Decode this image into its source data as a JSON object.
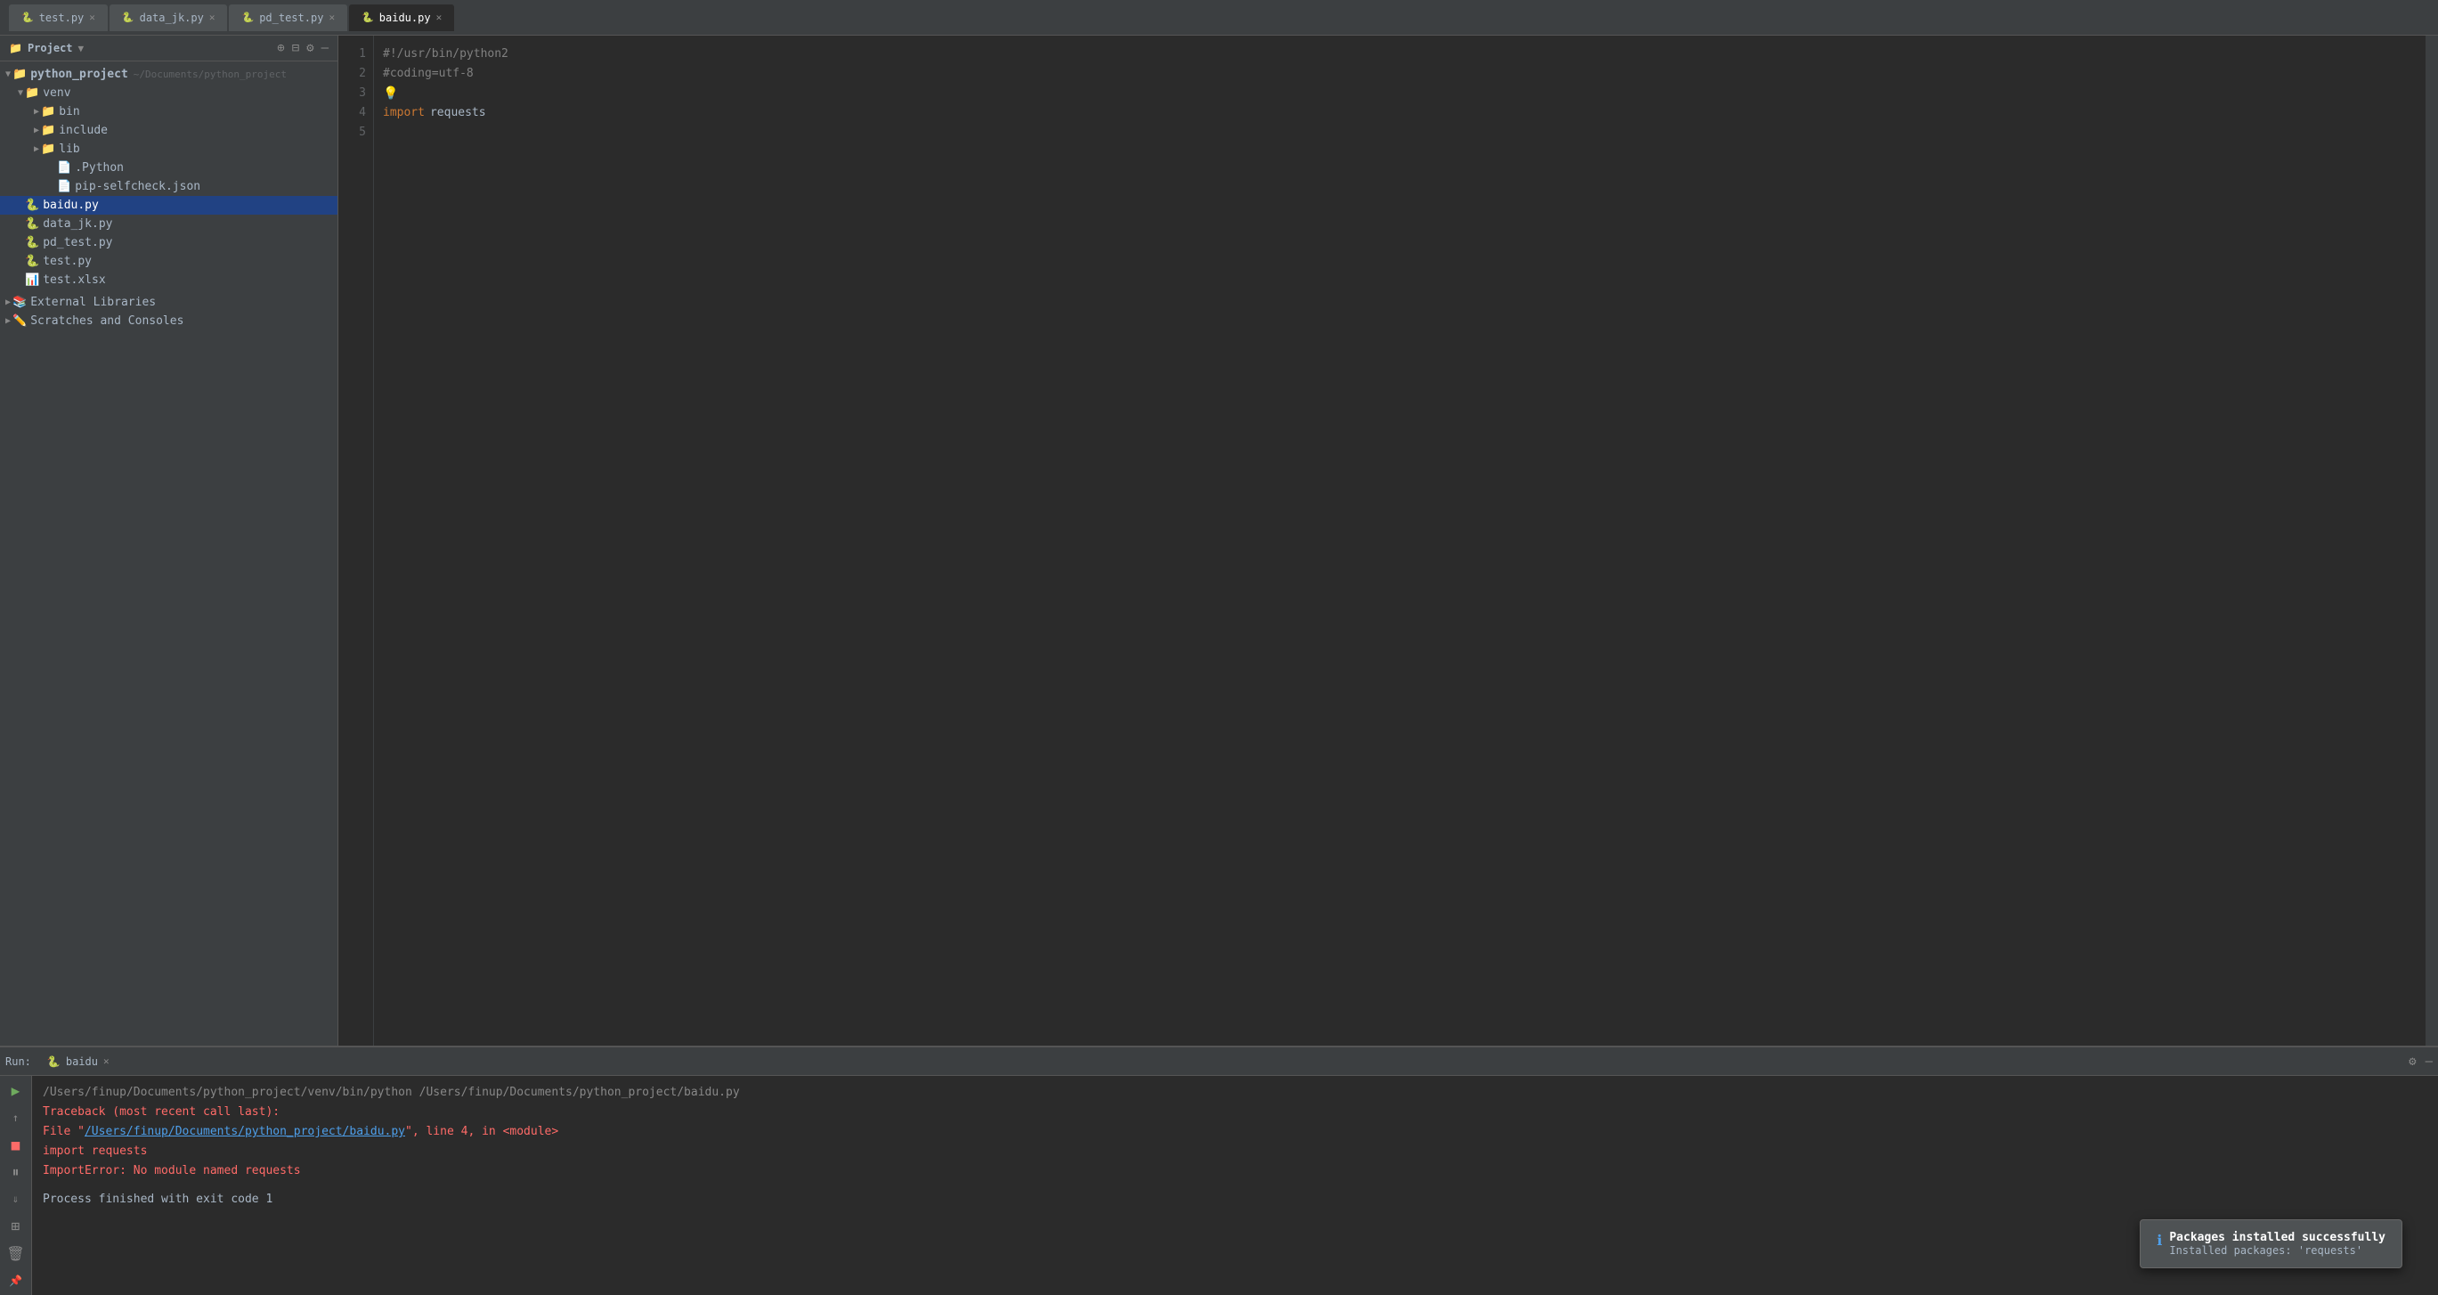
{
  "titlebar": {
    "tabs": [
      {
        "label": "test.py",
        "icon": "py",
        "active": false
      },
      {
        "label": "data_jk.py",
        "icon": "py",
        "active": false
      },
      {
        "label": "pd_test.py",
        "icon": "py",
        "active": false
      },
      {
        "label": "baidu.py",
        "icon": "py-orange",
        "active": true
      }
    ]
  },
  "sidebar": {
    "title": "Project",
    "project_name": "python_project",
    "project_path": "~/Documents/python_project",
    "tree": [
      {
        "indent": 0,
        "arrow": "▼",
        "icon": "folder",
        "label": "python_project",
        "path": "~/Documents/python_project",
        "selected": false
      },
      {
        "indent": 1,
        "arrow": "▼",
        "icon": "folder",
        "label": "venv",
        "selected": false
      },
      {
        "indent": 2,
        "arrow": "▶",
        "icon": "folder",
        "label": "bin",
        "selected": false
      },
      {
        "indent": 2,
        "arrow": "▶",
        "icon": "folder",
        "label": "include",
        "selected": false
      },
      {
        "indent": 2,
        "arrow": "▶",
        "icon": "folder",
        "label": "lib",
        "selected": false
      },
      {
        "indent": 3,
        "arrow": "",
        "icon": "folder",
        "label": ".Python",
        "selected": false
      },
      {
        "indent": 3,
        "arrow": "",
        "icon": "file-json",
        "label": "pip-selfcheck.json",
        "selected": false
      },
      {
        "indent": 1,
        "arrow": "",
        "icon": "file-py-orange",
        "label": "baidu.py",
        "selected": true
      },
      {
        "indent": 1,
        "arrow": "",
        "icon": "file-py",
        "label": "data_jk.py",
        "selected": false
      },
      {
        "indent": 1,
        "arrow": "",
        "icon": "file-py",
        "label": "pd_test.py",
        "selected": false
      },
      {
        "indent": 1,
        "arrow": "",
        "icon": "file-py",
        "label": "test.py",
        "selected": false
      },
      {
        "indent": 1,
        "arrow": "",
        "icon": "file-xlsx",
        "label": "test.xlsx",
        "selected": false
      }
    ],
    "external_libraries": "External Libraries",
    "scratches": "Scratches and Consoles"
  },
  "editor": {
    "active_file": "baidu.py",
    "lines": [
      {
        "num": 1,
        "content": "#!/usr/bin/python2",
        "type": "comment"
      },
      {
        "num": 2,
        "content": "#coding=utf-8",
        "type": "comment"
      },
      {
        "num": 3,
        "content": "",
        "type": "normal"
      },
      {
        "num": 4,
        "content": "import requests",
        "type": "import"
      },
      {
        "num": 5,
        "content": "",
        "type": "normal"
      }
    ]
  },
  "run_panel": {
    "label": "Run:",
    "tab_label": "baidu",
    "command": "/Users/finup/Documents/python_project/venv/bin/python /Users/finup/Documents/python_project/baidu.py",
    "traceback_header": "Traceback (most recent call last):",
    "file_line": "  File \"/Users/finup/Documents/python_project/baidu.py\", line 4, in <module>",
    "file_link": "/Users/finup/Documents/python_project/baidu.py",
    "import_line": "    import requests",
    "error_line": "ImportError: No module named requests",
    "exit_line": "Process finished with exit code 1"
  },
  "toast": {
    "icon": "ℹ",
    "title": "Packages installed successfully",
    "body": "Installed packages: 'requests'"
  },
  "colors": {
    "bg_dark": "#2b2b2b",
    "bg_panel": "#3c3f41",
    "accent_blue": "#4e9fea",
    "accent_orange": "#e8a74b",
    "error_red": "#ff6b68",
    "selected_blue": "#214283"
  }
}
